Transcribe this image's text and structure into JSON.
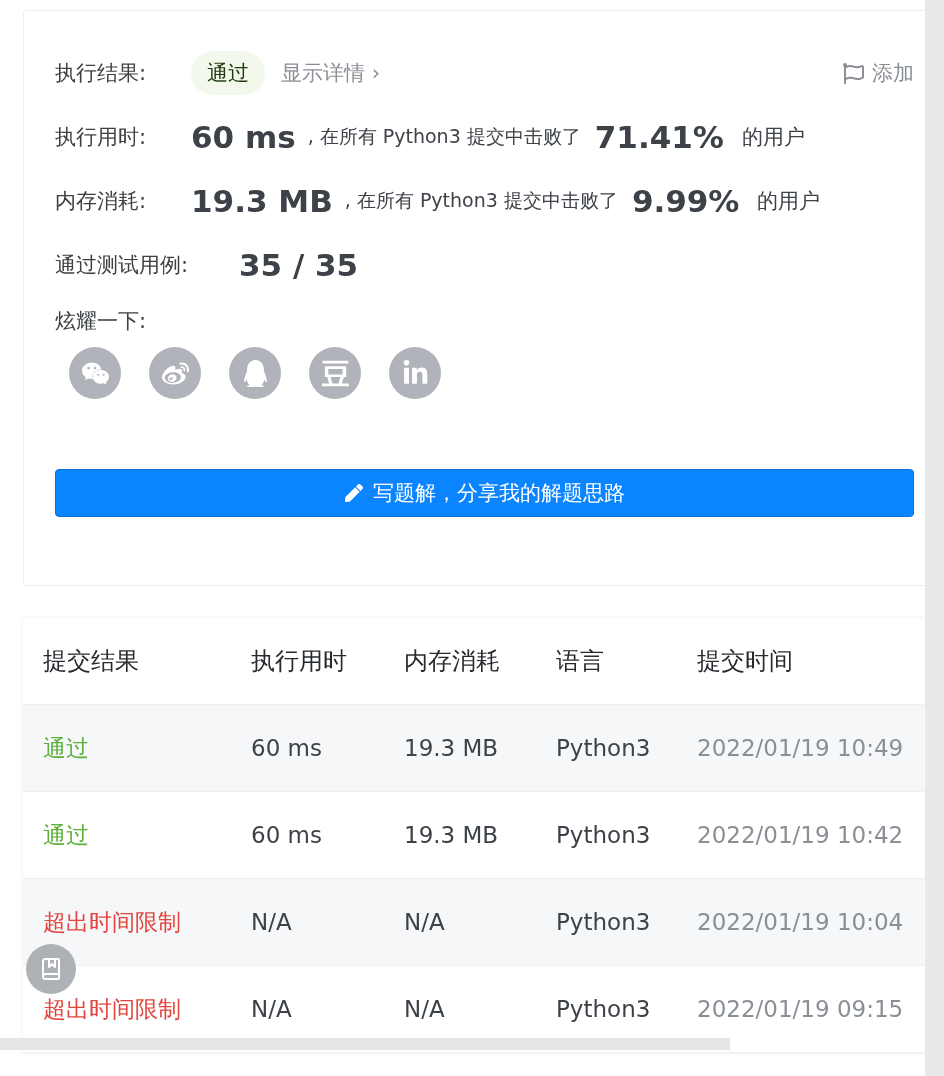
{
  "result": {
    "label": "执行结果:",
    "status": "通过",
    "details_link": "显示详情",
    "details_arrow": "›",
    "add_note": "添加"
  },
  "stats": [
    {
      "label": "执行用时:",
      "value": "60 ms",
      "middle": ", 在所有 Python3 提交中击败了",
      "percent": "71.41%",
      "suffix": "的用户"
    },
    {
      "label": "内存消耗:",
      "value": "19.3 MB",
      "middle": ", 在所有 Python3 提交中击败了",
      "percent": "9.99%",
      "suffix": "的用户"
    }
  ],
  "testcases": {
    "label": "通过测试用例:",
    "value": "35 / 35"
  },
  "share": {
    "label": "炫耀一下:",
    "buttons": [
      {
        "kind": "wechat"
      },
      {
        "kind": "weibo"
      },
      {
        "kind": "qq"
      },
      {
        "kind": "douban"
      },
      {
        "kind": "linkedin"
      }
    ]
  },
  "write_button": "写题解，分享我的解题思路",
  "table": {
    "columns": [
      "提交结果",
      "执行用时",
      "内存消耗",
      "语言",
      "提交时间"
    ],
    "rows": [
      {
        "kind": "passed",
        "cells": [
          "通过",
          "60 ms",
          "19.3 MB",
          "Python3",
          "2022/01/19 10:49"
        ]
      },
      {
        "kind": "passed",
        "cells": [
          "通过",
          "60 ms",
          "19.3 MB",
          "Python3",
          "2022/01/19 10:42"
        ]
      },
      {
        "kind": "failed",
        "cells": [
          "超出时间限制",
          "N/A",
          "N/A",
          "Python3",
          "2022/01/19 10:04"
        ]
      },
      {
        "kind": "failed",
        "cells": [
          "超出时间限制",
          "N/A",
          "N/A",
          "Python3",
          "2022/01/19 09:15"
        ]
      }
    ]
  }
}
